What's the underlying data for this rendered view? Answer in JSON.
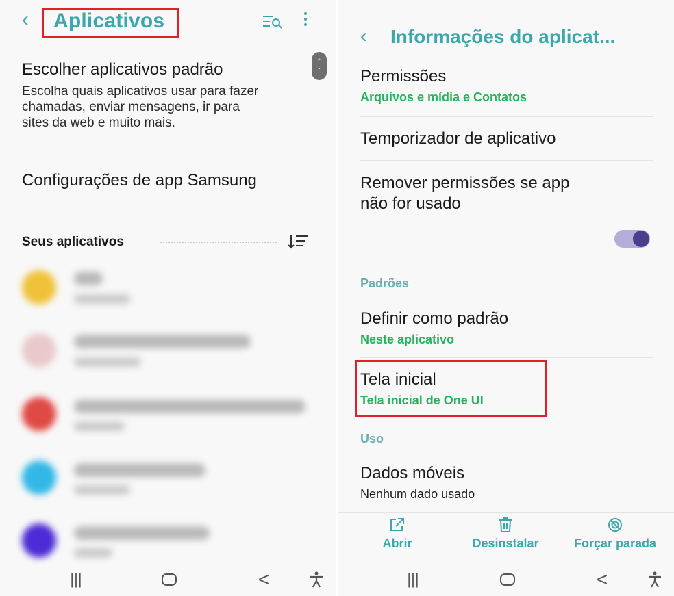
{
  "left": {
    "header": {
      "back_icon": "chevron-left-icon",
      "title": "Aplicativos",
      "search_icon": "list-search-icon",
      "more_icon": "kebab-icon"
    },
    "default_apps": {
      "title": "Escolher aplicativos padrão",
      "description_line1": "Escolha quais aplicativos usar para fazer",
      "description_line2": "chamadas, enviar mensagens, ir para",
      "description_line3": "sites da web e muito mais."
    },
    "samsung_settings": {
      "title": "Configurações de app Samsung"
    },
    "your_apps": {
      "label": "Seus aplicativos",
      "sort_icon": "sort-icon"
    },
    "apps": [
      {
        "icon_color": "#f0c239"
      },
      {
        "icon_color": "#e9c9cb"
      },
      {
        "icon_color": "#e04a45"
      },
      {
        "icon_color": "#32b8e6"
      },
      {
        "icon_color": "#4d2bd6"
      }
    ],
    "navbar": {
      "recents": "|||",
      "home": "home-icon",
      "back": "<",
      "accessibility": "accessibility-icon"
    }
  },
  "right": {
    "header": {
      "back_icon": "chevron-left-icon",
      "title": "Informações do aplicat..."
    },
    "permissions": {
      "title": "Permissões",
      "value": "Arquivos e mídia e Contatos"
    },
    "timer": {
      "title": "Temporizador de aplicativo"
    },
    "remove_perms": {
      "line1": "Remover permissões se app",
      "line2": "não for usado",
      "enabled": true
    },
    "section_defaults": "Padrões",
    "set_default": {
      "title": "Definir como padrão",
      "value": "Neste aplicativo"
    },
    "home_screen": {
      "title": "Tela inicial",
      "value": "Tela inicial de One UI"
    },
    "section_usage": "Uso",
    "mobile_data": {
      "title": "Dados móveis",
      "value": "Nenhum dado usado"
    },
    "actions": {
      "open": "Abrir",
      "uninstall": "Desinstalar",
      "force_stop": "Forçar parada"
    },
    "navbar": {
      "recents": "|||",
      "home": "home-icon",
      "back": "<",
      "accessibility": "accessibility-icon"
    }
  },
  "colors": {
    "accent": "#3aa8ac",
    "value_green": "#26b35d",
    "highlight_red": "#e0202a",
    "toggle_track": "#b6acd9",
    "toggle_knob": "#4b3e8c"
  }
}
